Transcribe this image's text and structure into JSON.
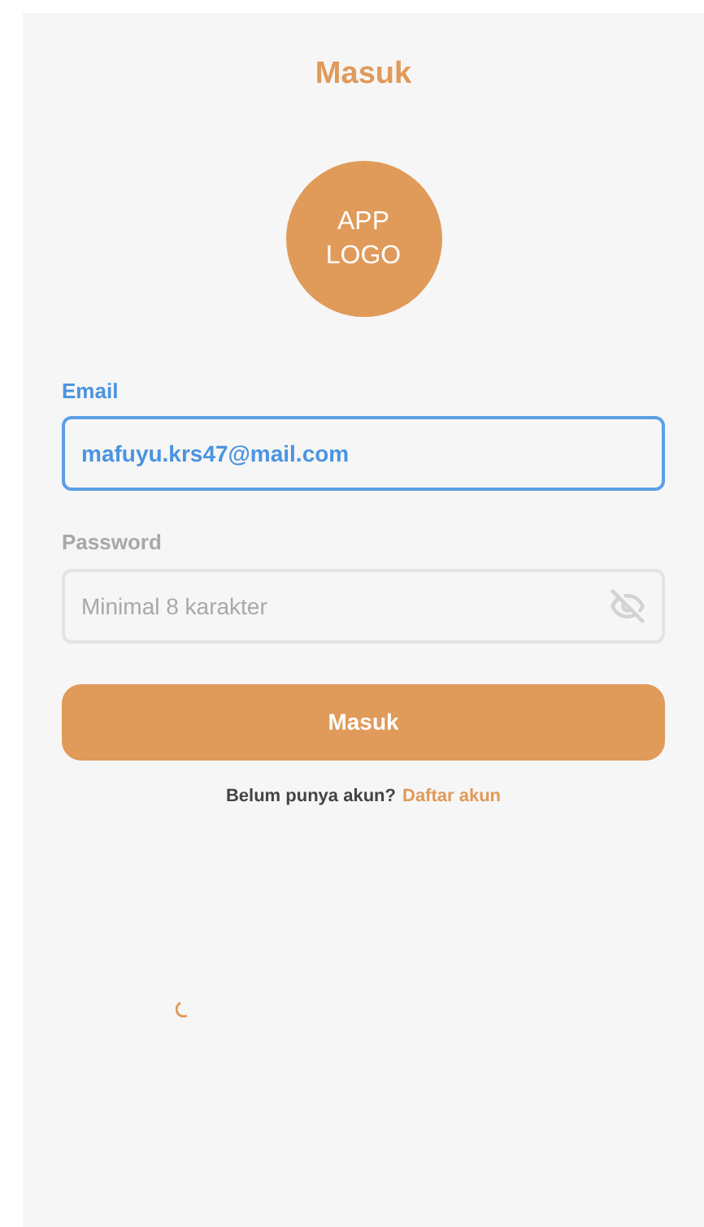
{
  "title": "Masuk",
  "logo": {
    "line_1": "APP",
    "line_2": "LOGO"
  },
  "fields": [
    {
      "label": "Email",
      "value": "mafuyu.krs47@mail.com",
      "focused": true,
      "disabled": false
    },
    {
      "label": "Password",
      "placeholder": "Minimal 8 karakter",
      "disabled": true,
      "obscured": true
    }
  ],
  "submit_button": "Masuk",
  "signup_prompt": {
    "text": "Belum punya akun?",
    "link": "Daftar akun"
  },
  "loading": true
}
